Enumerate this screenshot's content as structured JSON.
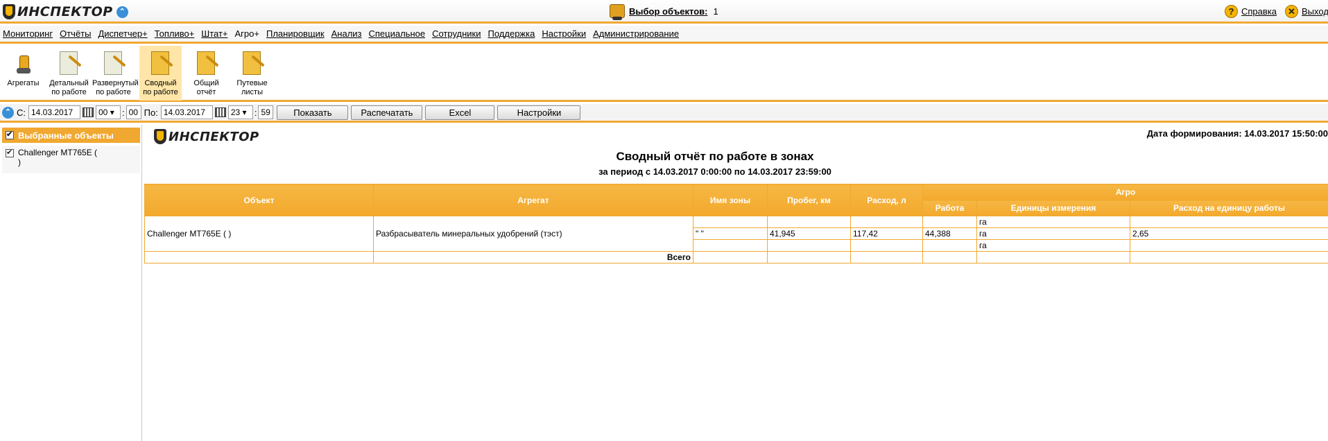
{
  "app": {
    "logo": "ИНСПЕКТОР"
  },
  "header": {
    "object_select_label": "Выбор объектов:",
    "object_count": "1",
    "help": "Справка",
    "exit": "Выход"
  },
  "menu": [
    "Мониторинг",
    "Отчёты",
    "Диспетчер+",
    "Топливо+",
    "Штат+",
    "Агро+",
    "Планировщик",
    "Анализ",
    "Специальное",
    "Сотрудники",
    "Поддержка",
    "Настройки",
    "Администрирование"
  ],
  "menu_active": "Агро+",
  "toolbar": {
    "aggregates": "Агрегаты",
    "detailed": [
      "Детальный",
      "по работе"
    ],
    "expanded": [
      "Развернутый",
      "по работе"
    ],
    "summary": [
      "Сводный",
      "по работе"
    ],
    "general": [
      "Общий",
      "отчёт"
    ],
    "waybills": [
      "Путевые",
      "листы"
    ]
  },
  "filter": {
    "from_label": "С:",
    "from_date": "14.03.2017",
    "from_hour": "00",
    "from_min": "00",
    "to_label": "По:",
    "to_date": "14.03.2017",
    "to_hour": "23",
    "to_min": "59",
    "colon": ":",
    "show": "Показать",
    "print": "Распечатать",
    "excel": "Excel",
    "settings": "Настройки"
  },
  "left_panel": {
    "header": "Выбранные объекты",
    "item_line1": "Challenger MT765E (",
    "item_line2": ")"
  },
  "report": {
    "logo": "ИНСПЕКТОР",
    "generated": "Дата формирования: 14.03.2017 15:50:00",
    "title": "Сводный отчёт по работе в зонах",
    "subtitle": "за период с 14.03.2017 0:00:00 по 14.03.2017 23:59:00",
    "columns": {
      "object": "Объект",
      "aggregate": "Агрегат",
      "zone": "Имя зоны",
      "mileage": "Пробег, км",
      "consumption": "Расход, л",
      "agro": "Агро",
      "work": "Работа",
      "units": "Единицы измерения",
      "per_unit": "Расход на единицу работы"
    },
    "object_cell": "Challenger MT765E (                )",
    "aggregate_cell": "Разбрасыватель минеральных удобрений (тэст)",
    "rows": [
      {
        "zone": "",
        "mileage": "",
        "consumption": "",
        "work": "",
        "units": "га",
        "per_unit": ""
      },
      {
        "zone": "\"            \"",
        "mileage": "41,945",
        "consumption": "117,42",
        "work": "44,388",
        "units": "га",
        "per_unit": "2,65"
      },
      {
        "zone": "",
        "mileage": "",
        "consumption": "",
        "work": "",
        "units": "га",
        "per_unit": ""
      }
    ],
    "total_label": "Всего"
  }
}
